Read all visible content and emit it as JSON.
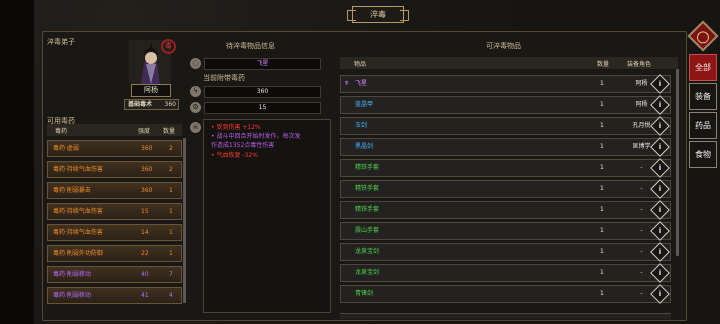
{
  "header": {
    "title": "淬毒"
  },
  "left": {
    "disciple_label": "淬毒弟子",
    "name": "阿杨",
    "skill_label": "基础毒术",
    "skill_value": "360",
    "available_label": "可用毒药",
    "columns": [
      "毒药",
      "强度",
      "数量"
    ],
    "rows": [
      {
        "name": "毒药·虚弱",
        "strength": "360",
        "count": "2",
        "tone": "orange"
      },
      {
        "name": "毒药·持续气血伤害",
        "strength": "360",
        "count": "2",
        "tone": "orange"
      },
      {
        "name": "毒药·削弱暴击",
        "strength": "360",
        "count": "1",
        "tone": "orange"
      },
      {
        "name": "毒药·持续气血伤害",
        "strength": "15",
        "count": "1",
        "tone": "orange"
      },
      {
        "name": "毒药·持续气血伤害",
        "strength": "14",
        "count": "1",
        "tone": "orange"
      },
      {
        "name": "毒药·削弱外功防御",
        "strength": "22",
        "count": "1",
        "tone": "orange"
      },
      {
        "name": "毒药·削弱移动",
        "strength": "40",
        "count": "7",
        "tone": "purple"
      },
      {
        "name": "毒药·削弱移动",
        "strength": "41",
        "count": "4",
        "tone": "purple"
      }
    ]
  },
  "middle": {
    "info_title": "待淬毒物品信息",
    "item_name": "飞星",
    "current_label": "当前附带毒药",
    "value_a": "360",
    "value_b": "15",
    "effects": [
      {
        "text": "• 受到伤害 +12%",
        "color": "#ff3b31"
      },
      {
        "text": "• 战斗中回合开始时发作，每次发",
        "color": "#b55ee8"
      },
      {
        "text": "作造成1352点毒性伤害",
        "color": "#b55ee8"
      },
      {
        "text": "• 气血恢复 -32%",
        "color": "#ff3b31"
      }
    ]
  },
  "right": {
    "title": "可淬毒物品",
    "columns": [
      "物品",
      "数量",
      "装备角色"
    ],
    "items": [
      {
        "name": "飞星",
        "qty": "1",
        "role": "阿杨",
        "color": "#d885ff"
      },
      {
        "name": "蓝晶甲",
        "qty": "1",
        "role": "阿杨",
        "color": "#47b5ff"
      },
      {
        "name": "玉剑",
        "qty": "1",
        "role": "孔月悦",
        "color": "#47b5ff"
      },
      {
        "name": "黑晶剑",
        "qty": "1",
        "role": "匡博学",
        "color": "#47b5ff"
      },
      {
        "name": "精铁手套",
        "qty": "1",
        "role": "-",
        "color": "#4ed64a"
      },
      {
        "name": "精铁手套",
        "qty": "1",
        "role": "-",
        "color": "#4ed64a"
      },
      {
        "name": "精铁手套",
        "qty": "1",
        "role": "-",
        "color": "#4ed64a"
      },
      {
        "name": "震山手套",
        "qty": "1",
        "role": "-",
        "color": "#4ed64a"
      },
      {
        "name": "龙泉宝剑",
        "qty": "1",
        "role": "-",
        "color": "#4ed64a"
      },
      {
        "name": "龙泉宝剑",
        "qty": "1",
        "role": "-",
        "color": "#4ed64a"
      },
      {
        "name": "青锋剑",
        "qty": "1",
        "role": "-",
        "color": "#4ed64a"
      }
    ]
  },
  "tabs": [
    "全部",
    "装备",
    "药品",
    "食物"
  ],
  "icons": [
    "back-icon",
    "poison-seal-icon",
    "item-icon",
    "power-icon",
    "gear-icon",
    "skull-icon",
    "info-icon"
  ]
}
